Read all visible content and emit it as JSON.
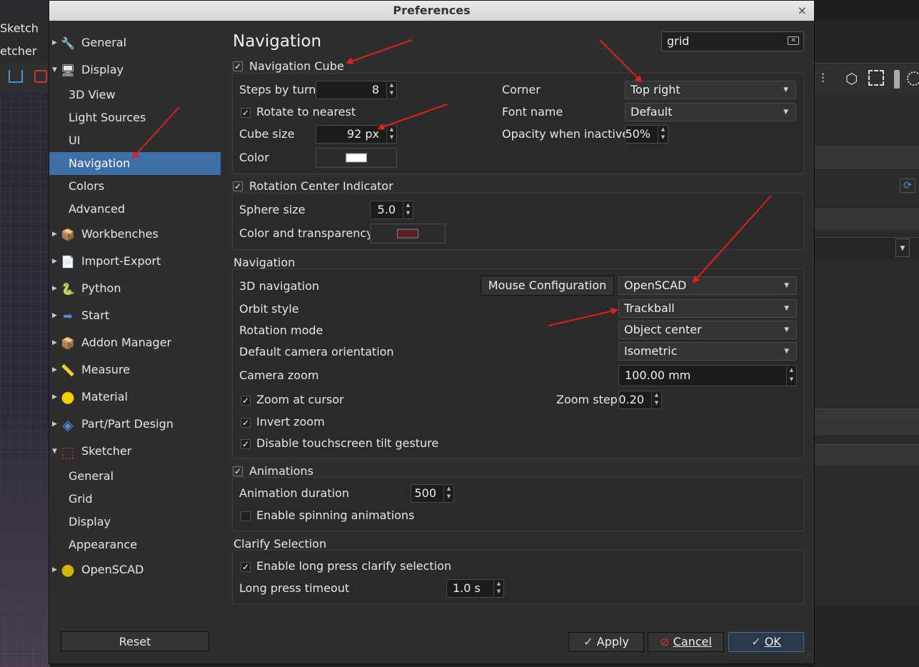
{
  "background": {
    "menu_sketch": "Sketch",
    "menu_sketcher": "etcher"
  },
  "dialog": {
    "title": "Preferences",
    "close_glyph": "×"
  },
  "tree": {
    "items": [
      {
        "label": "General",
        "icon": "wrench-icon",
        "glyph": "🔧"
      },
      {
        "label": "Display",
        "icon": "monitor-icon",
        "glyph": "🖥"
      },
      {
        "label": "3D View"
      },
      {
        "label": "Light Sources"
      },
      {
        "label": "UI"
      },
      {
        "label": "Navigation"
      },
      {
        "label": "Colors"
      },
      {
        "label": "Advanced"
      },
      {
        "label": "Workbenches",
        "icon": "workbench-icon",
        "glyph": "📦"
      },
      {
        "label": "Import-Export",
        "icon": "import-export-icon",
        "glyph": "📄"
      },
      {
        "label": "Python",
        "icon": "python-icon",
        "glyph": "🐍"
      },
      {
        "label": "Start",
        "icon": "start-arrow-icon",
        "glyph": "➡"
      },
      {
        "label": "Addon Manager",
        "icon": "addon-box-icon",
        "glyph": "📦"
      },
      {
        "label": "Measure",
        "icon": "caliper-icon",
        "glyph": "📏"
      },
      {
        "label": "Material",
        "icon": "material-sphere-icon",
        "glyph": "●"
      },
      {
        "label": "Part/Part Design",
        "icon": "part-cube-icon",
        "glyph": "◈"
      },
      {
        "label": "Sketcher",
        "icon": "sketcher-icon",
        "glyph": "⬚"
      },
      {
        "label": "General"
      },
      {
        "label": "Grid"
      },
      {
        "label": "Display"
      },
      {
        "label": "Appearance"
      },
      {
        "label": "OpenSCAD",
        "icon": "openscad-icon",
        "glyph": "●"
      }
    ],
    "reset_label": "Reset"
  },
  "page": {
    "title": "Navigation",
    "search_value": "grid"
  },
  "nav_cube": {
    "header": "Navigation Cube",
    "steps_label": "Steps by turn",
    "steps_value": "8",
    "rotate_label": "Rotate to nearest",
    "cube_size_label": "Cube size",
    "cube_size_value": "92 px",
    "color_label": "Color",
    "color_value": "#ffffff",
    "corner_label": "Corner",
    "corner_value": "Top right",
    "font_label": "Font name",
    "font_value": "Default",
    "opacity_label": "Opacity when inactive",
    "opacity_value": "50%"
  },
  "rotation_center": {
    "header": "Rotation Center Indicator",
    "sphere_label": "Sphere size",
    "sphere_value": "5.0",
    "color_label": "Color and transparency",
    "color_value": "#5a1f26"
  },
  "navigation": {
    "header": "Navigation",
    "nav3d_label": "3D navigation",
    "mouse_config_label": "Mouse Configuration",
    "nav3d_value": "OpenSCAD",
    "orbit_label": "Orbit style",
    "orbit_value": "Trackball",
    "rotation_mode_label": "Rotation mode",
    "rotation_mode_value": "Object center",
    "camera_orient_label": "Default camera orientation",
    "camera_orient_value": "Isometric",
    "camera_zoom_label": "Camera zoom",
    "camera_zoom_value": "100.00 mm",
    "zoom_cursor_label": "Zoom at cursor",
    "zoom_step_label": "Zoom step",
    "zoom_step_value": "0.20",
    "invert_zoom_label": "Invert zoom",
    "disable_tilt_label": "Disable touchscreen tilt gesture"
  },
  "animations": {
    "header": "Animations",
    "duration_label": "Animation duration",
    "duration_value": "500",
    "spinning_label": "Enable spinning animations"
  },
  "clarify": {
    "header": "Clarify Selection",
    "long_press_label": "Enable long press clarify selection",
    "timeout_label": "Long press timeout",
    "timeout_value": "1.0 s"
  },
  "buttons": {
    "apply": "Apply",
    "cancel": "Cancel",
    "ok": "OK"
  },
  "check_glyph": "✓",
  "colors": {
    "selection": "#3d6ea8",
    "annotation_arrow": "#e0201a"
  }
}
